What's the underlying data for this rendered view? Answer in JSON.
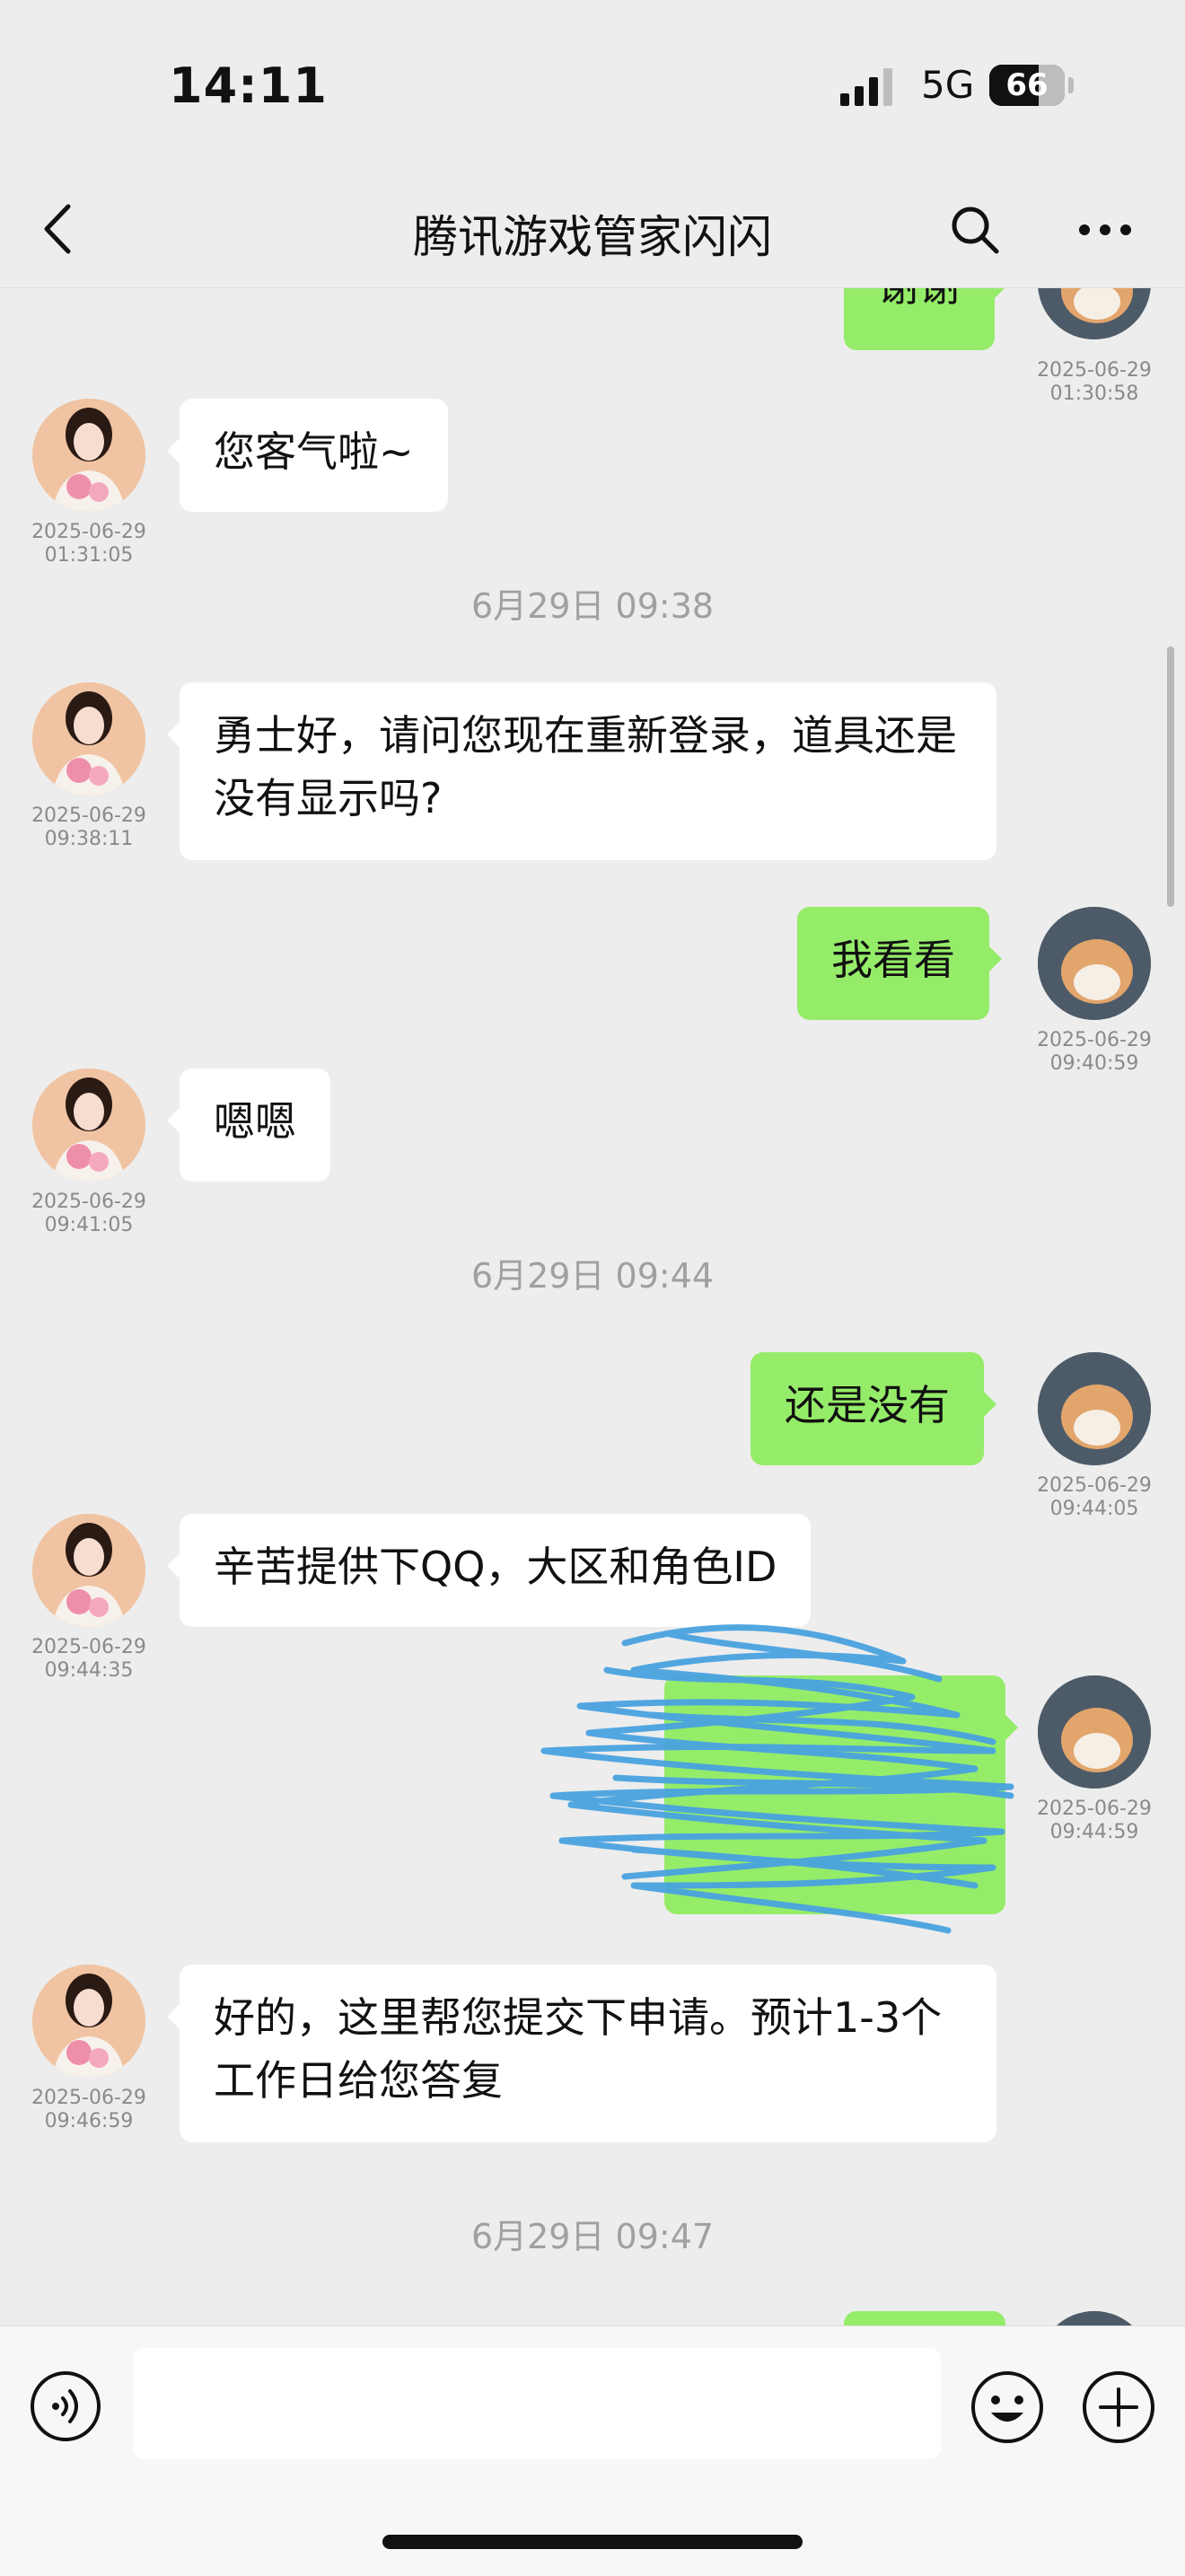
{
  "status_bar": {
    "time": "14:11",
    "network": "5G",
    "battery": "66",
    "battery_level": 0.66
  },
  "header": {
    "title": "腾讯游戏管家闪闪"
  },
  "messages": [
    {
      "from": "user",
      "text": "谢谢",
      "date": "2025-06-29",
      "time": "01:30:58"
    },
    {
      "from": "agent",
      "text": "您客气啦~",
      "date": "2025-06-29",
      "time": "01:31:05"
    },
    {
      "divider": "6月29日 09:38"
    },
    {
      "from": "agent",
      "text": "勇士好，请问您现在重新登录，道具还是没有显示吗?",
      "date": "2025-06-29",
      "time": "09:38:11"
    },
    {
      "from": "user",
      "text": "我看看",
      "date": "2025-06-29",
      "time": "09:40:59"
    },
    {
      "from": "agent",
      "text": "嗯嗯",
      "date": "2025-06-29",
      "time": "09:41:05"
    },
    {
      "divider": "6月29日 09:44"
    },
    {
      "from": "user",
      "text": "还是没有",
      "date": "2025-06-29",
      "time": "09:44:05"
    },
    {
      "from": "agent",
      "text": "辛苦提供下QQ，大区和角色ID",
      "date": "2025-06-29",
      "time": "09:44:35"
    },
    {
      "from": "user",
      "text": "",
      "redacted": true,
      "date": "2025-06-29",
      "time": "09:44:59"
    },
    {
      "from": "agent",
      "text": "好的，这里帮您提交下申请。预计1-3个工作日给您答复",
      "date": "2025-06-29",
      "time": "09:46:59"
    },
    {
      "divider": "6月29日 09:47"
    }
  ],
  "colors": {
    "outgoing_bubble": "#95ec69",
    "incoming_bubble": "#ffffff",
    "background": "#ededed",
    "redaction": "#4aa3e0"
  },
  "icons": [
    "back-icon",
    "search-icon",
    "more-icon",
    "voice-icon",
    "emoji-icon",
    "plus-icon"
  ]
}
